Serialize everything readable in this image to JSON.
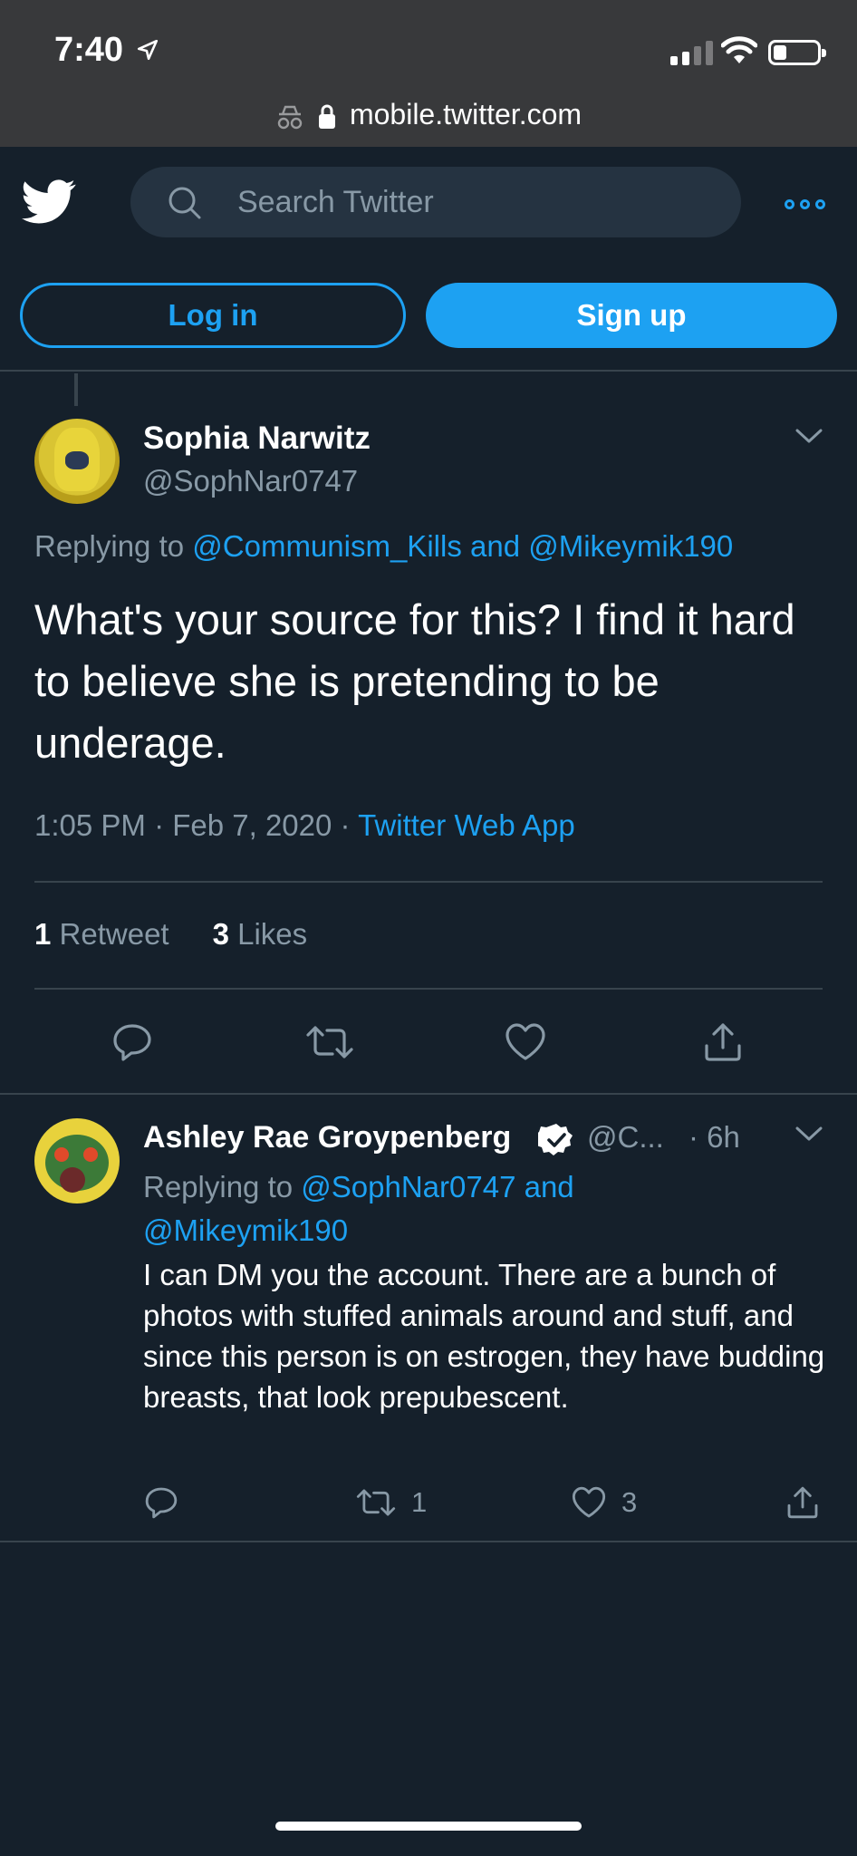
{
  "status_bar": {
    "time": "7:40"
  },
  "browser": {
    "url": "mobile.twitter.com"
  },
  "header": {
    "search_placeholder": "Search Twitter",
    "login_label": "Log in",
    "signup_label": "Sign up"
  },
  "colors": {
    "accent": "#1da1f2",
    "background": "#15202b",
    "muted": "#8899a6",
    "border": "#38444d"
  },
  "main_tweet": {
    "name": "Sophia Narwitz",
    "handle": "@SophNar0747",
    "replying_prefix": "Replying to ",
    "replying_targets": "@Communism_Kills and @Mikeymik190",
    "text": "What's your source for this? I find it hard to believe she is pretending to be underage.",
    "timestamp": "1:05 PM · Feb 7, 2020 · ",
    "source": "Twitter Web App",
    "retweets_count": "1",
    "retweets_label": "Retweet",
    "likes_count": "3",
    "likes_label": "Likes"
  },
  "reply_tweet": {
    "name": "Ashley Rae Groypenberg",
    "handle": "@C...",
    "time": "· 6h",
    "replying_prefix": "Replying to ",
    "replying_targets": "@SophNar0747 and @Mikeymik190",
    "text": "I can DM you the account. There are a bunch of photos with stuffed animals around and stuff, and since this person is on estrogen, they have budding breasts, that look prepubescent.",
    "retweet_count": "1",
    "like_count": "3"
  }
}
